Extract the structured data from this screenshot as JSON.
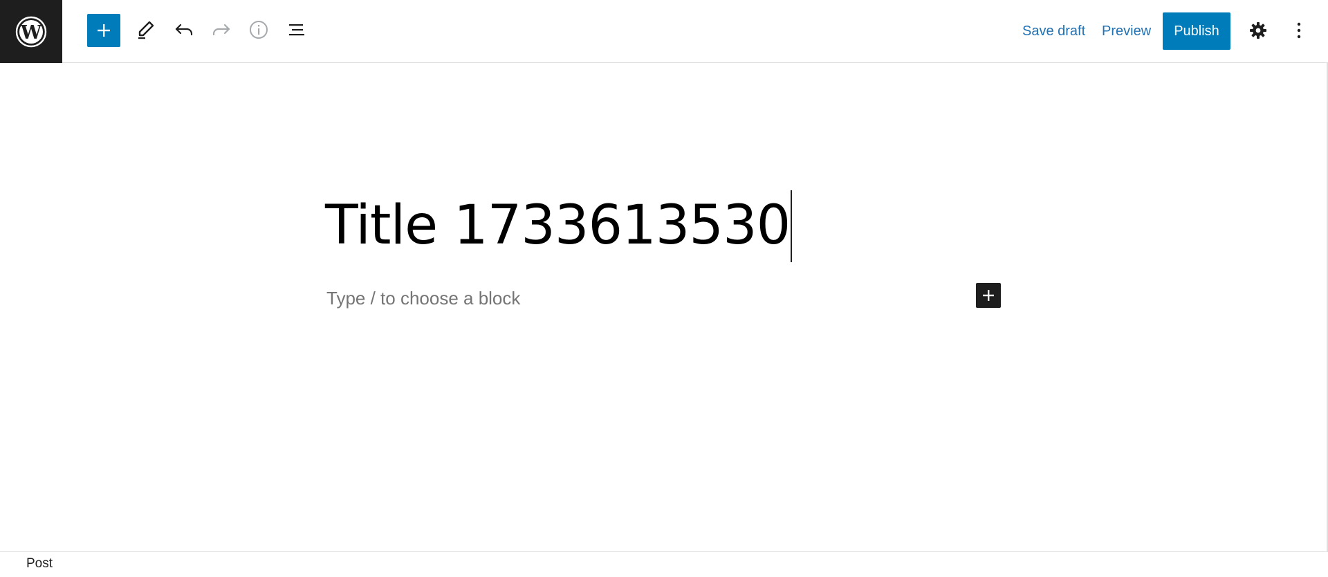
{
  "toolbar": {
    "logo_icon": "wordpress-logo-icon",
    "inserter_icon": "plus-icon",
    "tools_icon": "pencil-icon",
    "undo_icon": "undo-icon",
    "redo_icon": "redo-icon",
    "details_icon": "info-icon",
    "list_view_icon": "list-view-icon",
    "save_draft_label": "Save draft",
    "preview_label": "Preview",
    "publish_label": "Publish",
    "settings_icon": "gear-icon",
    "options_icon": "more-vertical-icon"
  },
  "editor": {
    "title": "Title 1733613530",
    "block_placeholder": "Type / to choose a block",
    "add_block_icon": "plus-icon"
  },
  "footer": {
    "breadcrumb": "Post"
  },
  "colors": {
    "accent": "#007cba",
    "link": "#2271b1",
    "dark": "#1e1e1e",
    "border": "#e0e0e0",
    "placeholder": "#757575",
    "disabled_icon": "#a7aaad"
  }
}
